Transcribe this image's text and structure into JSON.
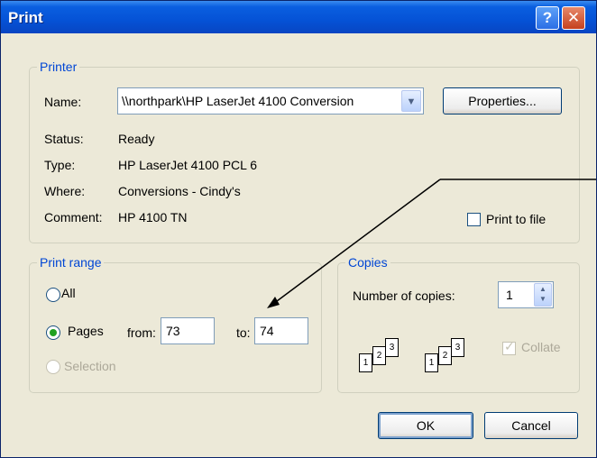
{
  "window": {
    "title": "Print"
  },
  "titlebar_buttons": {
    "help": "?",
    "close": "✕"
  },
  "printer": {
    "legend": "Printer",
    "name_label": "Name:",
    "name_value": "\\\\northpark\\HP LaserJet 4100 Conversion",
    "properties_button": "Properties...",
    "status_label": "Status:",
    "status_value": "Ready",
    "type_label": "Type:",
    "type_value": "HP LaserJet 4100 PCL 6",
    "where_label": "Where:",
    "where_value": "Conversions - Cindy's",
    "comment_label": "Comment:",
    "comment_value": "HP 4100 TN",
    "print_to_file_label": "Print to file",
    "print_to_file_checked": false
  },
  "print_range": {
    "legend": "Print range",
    "all_label": "All",
    "pages_label": "Pages",
    "from_label": "from:",
    "from_value": "73",
    "to_label": "to:",
    "to_value": "74",
    "selection_label": "Selection",
    "selected": "pages"
  },
  "copies": {
    "legend": "Copies",
    "number_label": "Number of copies:",
    "number_value": "1",
    "collate_label": "Collate",
    "collate_checked": true,
    "collate_disabled": true,
    "collate_icon_pages": [
      "1",
      "2",
      "3"
    ]
  },
  "buttons": {
    "ok": "OK",
    "cancel": "Cancel"
  },
  "colors": {
    "title_bar": "#0552d6",
    "group_label": "#0046d5",
    "dialog_bg": "#ece9d8",
    "annotation_line": "#000000"
  }
}
